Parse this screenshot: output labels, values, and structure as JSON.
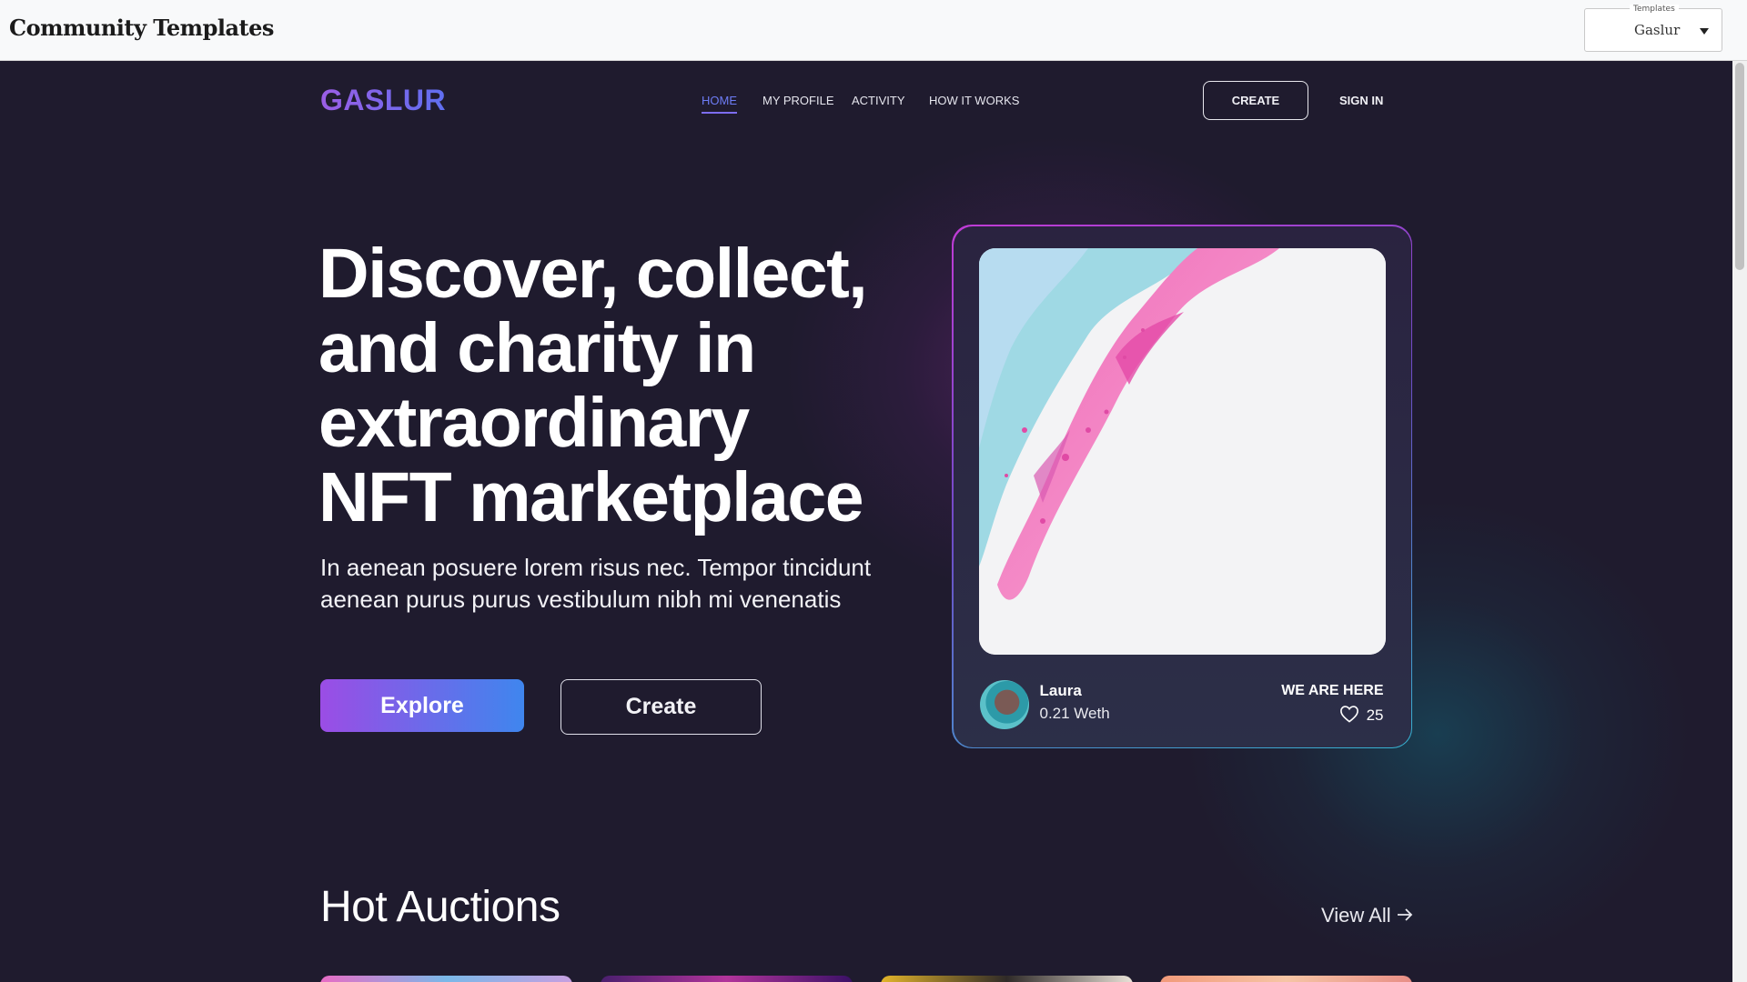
{
  "host": {
    "brand": "Community Templates",
    "template_select": {
      "legend": "Templates",
      "value": "Gaslur"
    }
  },
  "nav": {
    "logo": "GASLUR",
    "links": [
      {
        "label": "HOME",
        "active": true
      },
      {
        "label": "MY PROFILE"
      },
      {
        "label": "ACTIVITY"
      },
      {
        "label": "HOW IT WORKS"
      }
    ],
    "create_label": "CREATE",
    "signin_label": "SIGN IN"
  },
  "hero": {
    "title_lines": [
      "Discover, collect,",
      "and charity in",
      "extraordinary",
      "NFT marketplace"
    ],
    "subtitle": "In aenean posuere lorem risus nec. Tempor tincidunt aenean purus purus vestibulum nibh mi venenatis",
    "explore_label": "Explore",
    "create_label": "Create"
  },
  "featured": {
    "owner": "Laura",
    "price": "0.21 Weth",
    "tag": "WE ARE HERE",
    "likes": "25"
  },
  "auctions": {
    "title": "Hot Auctions",
    "view_all": "View All"
  },
  "colors": {
    "background": "#1f1b2e",
    "accent_purple": "#9b4de5",
    "accent_blue": "#3f86ee",
    "nav_active": "#6d7cf5"
  },
  "icons": {
    "heart": "heart-icon",
    "arrow": "arrow-right-icon",
    "caret": "chevron-down-icon"
  }
}
